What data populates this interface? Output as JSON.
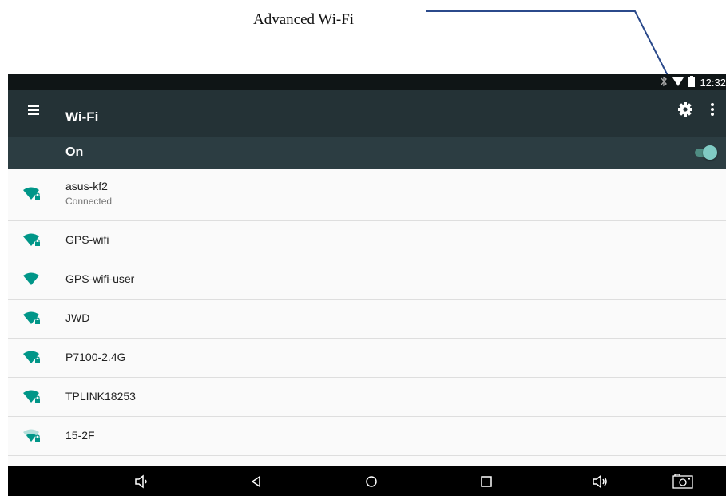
{
  "annotation": {
    "label": "Advanced Wi-Fi"
  },
  "status_bar": {
    "time": "12:32"
  },
  "app_bar": {
    "title": "Wi-Fi"
  },
  "wifi_toggle": {
    "label": "On",
    "enabled": true
  },
  "networks": [
    {
      "name": "asus-kf2",
      "status": "Connected",
      "secured": true
    },
    {
      "name": "GPS-wifi",
      "secured": true
    },
    {
      "name": "GPS-wifi-user",
      "secured": false
    },
    {
      "name": "JWD",
      "secured": true
    },
    {
      "name": "P7100-2.4G",
      "secured": true
    },
    {
      "name": "TPLINK18253",
      "secured": true
    },
    {
      "name": "15-2F",
      "secured": true
    }
  ],
  "colors": {
    "accent": "#009688",
    "app_bar": "#243236",
    "toggle_bar": "#2c3d42",
    "callout_line": "#2b4a8b"
  },
  "icons": {
    "menu": "hamburger-menu-icon",
    "settings": "gear-icon",
    "overflow": "more-vert-icon",
    "network": "wifi-signal-icon"
  }
}
